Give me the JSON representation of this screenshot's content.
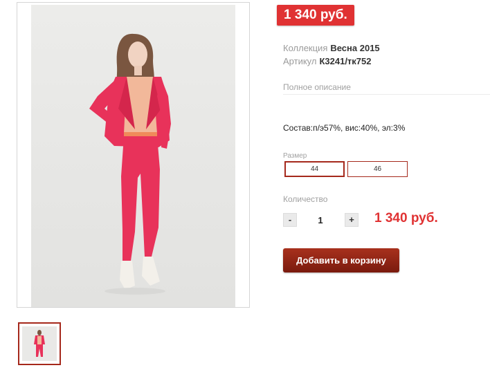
{
  "product": {
    "price_badge": "1 340 руб.",
    "collection_label": "Коллекция",
    "collection_value": "Весна 2015",
    "article_label": "Артикул",
    "article_value": "К3241/тк752",
    "description_title": "Полное описание",
    "composition": "Состав:п/э57%, вис:40%, эл:3%",
    "size_label": "Размер",
    "sizes": [
      {
        "label": "44",
        "selected": true
      },
      {
        "label": "46",
        "selected": false
      }
    ],
    "quantity_label": "Количество",
    "quantity_minus": "-",
    "quantity_value": "1",
    "quantity_plus": "+",
    "total_price": "1 340 руб.",
    "add_to_cart": "Добавить в корзину"
  },
  "colors": {
    "accent_red": "#e03233",
    "selected_border": "#a5281b",
    "button_dark": "#7a1a0e",
    "suit_color": "#e8325a",
    "blouse_color": "#f2b89a"
  },
  "images": {
    "main_photo": "product-photo-red-suit",
    "thumbnail": "product-thumbnail-red-suit"
  }
}
